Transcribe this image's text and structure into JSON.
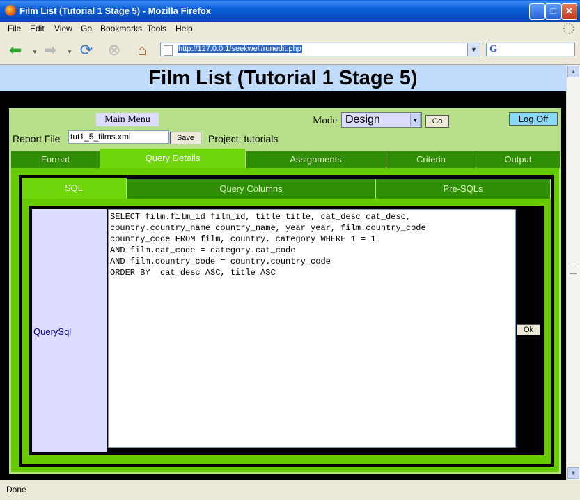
{
  "window": {
    "title": "Film List (Tutorial 1 Stage 5) - Mozilla Firefox",
    "min": "_",
    "max": "□",
    "close": "✕"
  },
  "menu": [
    {
      "label": "File"
    },
    {
      "label": "Edit"
    },
    {
      "label": "View"
    },
    {
      "label": "Go"
    },
    {
      "label": "Bookmarks"
    },
    {
      "label": "Tools"
    },
    {
      "label": "Help"
    }
  ],
  "nav": {
    "url": "http://127.0.0.1/seekwell/runedit.php",
    "search_engine": "G"
  },
  "page": {
    "heading": "Film List (Tutorial 1 Stage 5)",
    "main_menu": "Main Menu",
    "mode_label": "Mode",
    "mode_value": "Design",
    "go_button": "Go",
    "logoff_button": "Log Off",
    "report_file_label": "Report File",
    "report_file_value": "tut1_5_films.xml",
    "save_button": "Save",
    "project_label": "Project: tutorials",
    "tabs": [
      {
        "label": "Format"
      },
      {
        "label": "Query Details"
      },
      {
        "label": "Assignments"
      },
      {
        "label": "Criteria"
      },
      {
        "label": "Output"
      }
    ],
    "active_tab": "Query Details",
    "subtabs": [
      {
        "label": "SQL"
      },
      {
        "label": "Query Columns"
      },
      {
        "label": "Pre-SQLs"
      }
    ],
    "active_subtab": "SQL",
    "query_label": "QuerySql",
    "sql": "SELECT film.film_id film_id, title title, cat_desc cat_desc,\ncountry.country_name country_name, year year, film.country_code\ncountry_code FROM film, country, category WHERE 1 = 1\nAND film.cat_code = category.cat_code\nAND film.country_code = country.country_code\nORDER BY  cat_desc ASC, title ASC",
    "ok_button": "Ok"
  },
  "status": {
    "text": "Done"
  }
}
